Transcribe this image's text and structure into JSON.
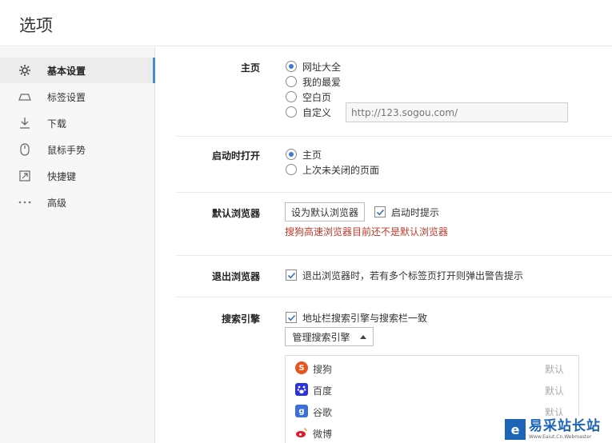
{
  "window": {
    "title": "选项"
  },
  "sidebar": {
    "items": [
      {
        "label": "基本设置",
        "icon": "gear-icon",
        "active": true
      },
      {
        "label": "标签设置",
        "icon": "tab-icon"
      },
      {
        "label": "下载",
        "icon": "download-icon"
      },
      {
        "label": "鼠标手势",
        "icon": "mouse-icon"
      },
      {
        "label": "快捷键",
        "icon": "shortcut-icon"
      },
      {
        "label": "高级",
        "icon": "more-icon"
      }
    ]
  },
  "homepage": {
    "label": "主页",
    "options": [
      "网址大全",
      "我的最爱",
      "空白页",
      "自定义"
    ],
    "selected": "网址大全",
    "custom_url_placeholder": "http://123.sogou.com/"
  },
  "startup": {
    "label": "启动时打开",
    "options": [
      "主页",
      "上次未关闭的页面"
    ],
    "selected": "主页"
  },
  "default_browser": {
    "label": "默认浏览器",
    "button": "设为默认浏览器",
    "check_label": "启动时提示",
    "checked": true,
    "warning": "搜狗高速浏览器目前还不是默认浏览器",
    "warning_color": "#c0392b"
  },
  "exit_browser": {
    "label": "退出浏览器",
    "check_label": "退出浏览器时，若有多个标签页打开则弹出警告提示",
    "checked": true
  },
  "search_engine": {
    "label": "搜索引擎",
    "check_label": "地址栏搜索引擎与搜索栏一致",
    "checked": true,
    "manage_button": "管理搜索引擎",
    "engines": [
      {
        "name": "搜狗",
        "default_label": "默认",
        "icon": "sogou-icon",
        "color": "#e8541e"
      },
      {
        "name": "百度",
        "default_label": "默认",
        "icon": "baidu-icon",
        "color": "#2932e1"
      },
      {
        "name": "谷歌",
        "default_label": "默认",
        "icon": "google-icon",
        "color": "#3b6fd8"
      },
      {
        "name": "微博",
        "default_label": "",
        "icon": "weibo-icon",
        "color": "#e6162d"
      }
    ]
  },
  "watermark": {
    "logo_char": "e",
    "text": "易采站长站",
    "subtext": "Www.Eaiut.Cn.Webmaster"
  },
  "colors": {
    "accent": "#4a8ad4",
    "radio_on": "#3a7bd5"
  }
}
